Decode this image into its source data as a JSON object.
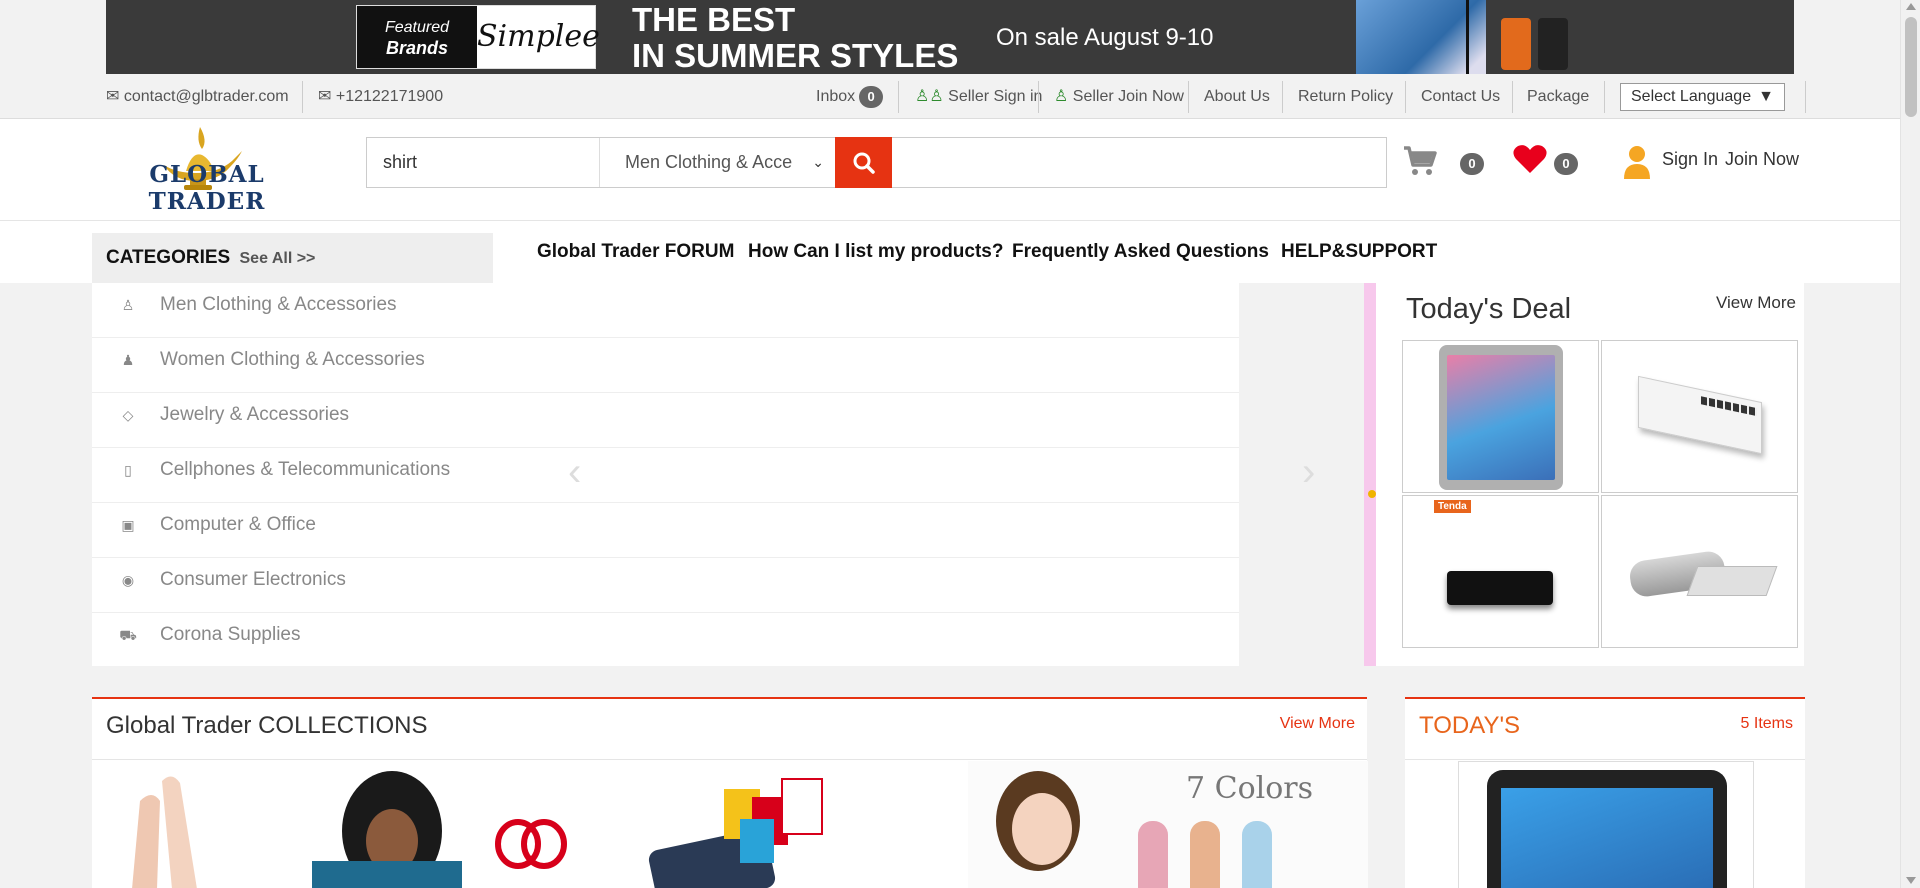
{
  "banner": {
    "featured_line1": "Featured",
    "featured_line2": "Brands",
    "brand": "Simplee",
    "headline_line1": "THE BEST",
    "headline_line2": "IN SUMMER STYLES",
    "sale_text": "On sale August 9-10"
  },
  "topbar": {
    "email": "contact@glbtrader.com",
    "phone": "+12122171900",
    "inbox_label": "Inbox",
    "inbox_count": "0",
    "seller_signin": "Seller Sign in",
    "seller_join": "Seller Join Now",
    "about": "About Us",
    "return_policy": "Return Policy",
    "contact": "Contact Us",
    "package": "Package",
    "language": "Select Language"
  },
  "header": {
    "logo_text": "GLOBAL TRADER",
    "search_value": "shirt",
    "category_selected": "Men Clothing & Acce",
    "cart_count": "0",
    "wishlist_count": "0",
    "signin": "Sign In",
    "join": "Join Now"
  },
  "nav": {
    "categories": "CATEGORIES",
    "see_all": "See All >>",
    "links": [
      "Global Trader FORUM",
      "How Can I list my products?",
      "Frequently Asked Questions",
      "HELP&SUPPORT"
    ]
  },
  "categories": [
    {
      "label": "Men Clothing & Accessories",
      "icon": "person-icon"
    },
    {
      "label": "Women Clothing & Accessories",
      "icon": "woman-icon"
    },
    {
      "label": "Jewelry & Accessories",
      "icon": "diamond-icon"
    },
    {
      "label": "Cellphones & Telecommunications",
      "icon": "mobile-icon"
    },
    {
      "label": "Computer & Office",
      "icon": "desktop-icon"
    },
    {
      "label": "Consumer Electronics",
      "icon": "camera-icon"
    },
    {
      "label": "Corona Supplies",
      "icon": "ambulance-icon"
    }
  ],
  "deal": {
    "title": "Today's Deal",
    "view_more": "View More",
    "products": [
      "tablet",
      "network-switch",
      "tenda-router",
      "speaker"
    ],
    "router_brand": "Tenda"
  },
  "collections": {
    "title": "Global Trader COLLECTIONS",
    "view_more": "View More",
    "colors_text": "7 Colors"
  },
  "todays": {
    "title": "TODAY'S",
    "items": "5 Items"
  },
  "colors": {
    "accent": "#e63312",
    "orange": "#e8651c",
    "logo_blue": "#1b3b6b",
    "deal_border": "#f7c8ec"
  }
}
